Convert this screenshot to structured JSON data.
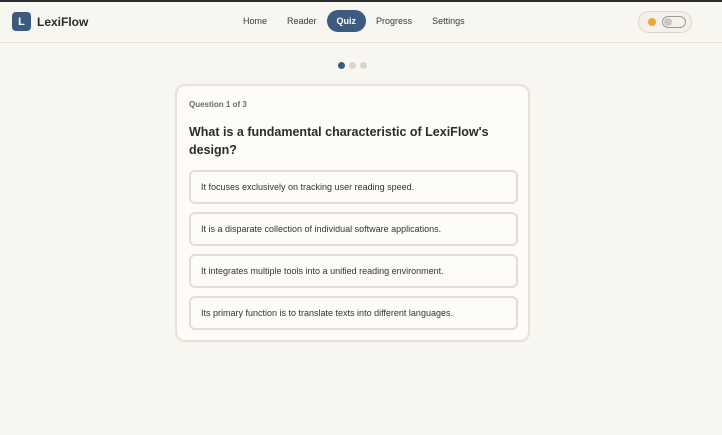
{
  "app": {
    "logo_letter": "L",
    "name": "LexiFlow"
  },
  "nav": {
    "items": [
      {
        "label": "Home"
      },
      {
        "label": "Reader"
      },
      {
        "label": "Quiz",
        "active": true
      },
      {
        "label": "Progress"
      },
      {
        "label": "Settings"
      }
    ]
  },
  "theme": {
    "icon": "sun-icon",
    "toggle_state": "off"
  },
  "quiz": {
    "current": 1,
    "total": 3,
    "progress_label": "Question 1 of 3",
    "question": "What is a fundamental characteristic of LexiFlow's design?",
    "options": [
      {
        "text": "It focuses exclusively on tracking user reading speed."
      },
      {
        "text": "It is a disparate collection of individual software applications."
      },
      {
        "text": "It integrates multiple tools into a unified reading environment."
      },
      {
        "text": "Its primary function is to translate texts into different languages."
      }
    ]
  },
  "colors": {
    "accent": "#3d5a80",
    "background": "#f8f6f1",
    "sun": "#e9a93a"
  }
}
